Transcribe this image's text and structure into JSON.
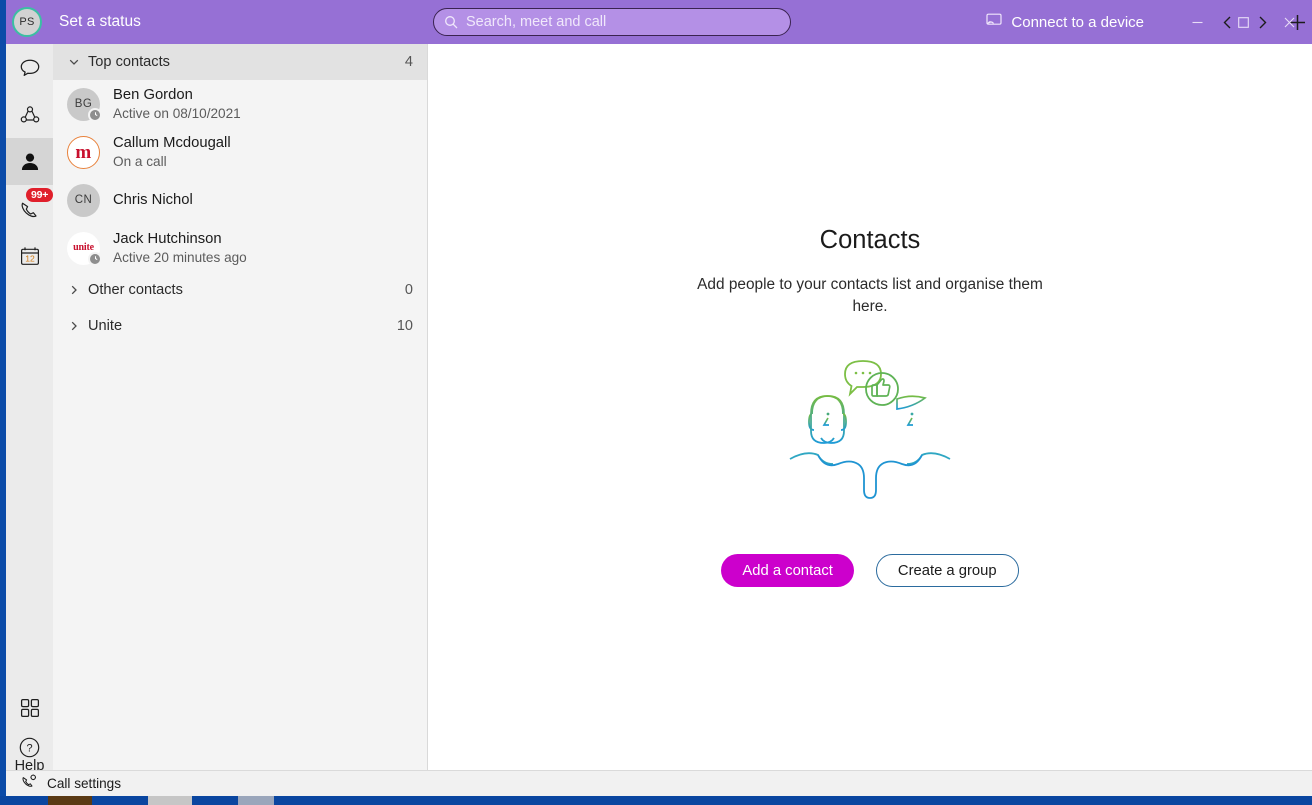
{
  "window": {
    "titlebar": {
      "avatar_initials": "PS",
      "status_label": "Set a status",
      "back_icon": "chevron-left-icon",
      "forward_icon": "chevron-right-icon",
      "new_icon": "plus-icon",
      "connect_label": "Connect to a device",
      "connect_icon": "cast-icon",
      "minimize_icon": "minimize-icon",
      "maximize_icon": "maximize-icon",
      "close_icon": "close-icon"
    },
    "search": {
      "placeholder": "Search, meet and call",
      "value": "",
      "icon": "search-icon"
    }
  },
  "rail": {
    "items": [
      {
        "name": "chat",
        "icon": "chat-bubble-icon",
        "badge": "",
        "active": false
      },
      {
        "name": "meet",
        "icon": "meet-now-icon",
        "badge": "",
        "active": false
      },
      {
        "name": "contacts",
        "icon": "person-icon",
        "badge": "",
        "active": true
      },
      {
        "name": "calls",
        "icon": "phone-icon",
        "badge": "99+",
        "active": false
      },
      {
        "name": "calendar",
        "icon": "calendar-icon",
        "badge": "",
        "active": false,
        "day": "12"
      }
    ],
    "apps_icon": "apps-grid-icon",
    "help_icon": "question-circle-icon",
    "help_label": "Help"
  },
  "contacts_panel": {
    "groups": [
      {
        "title": "Top contacts",
        "count": "4",
        "expanded": true,
        "caret": "chevron-down-icon",
        "contacts": [
          {
            "name": "Ben Gordon",
            "status": "Active on 08/10/2021",
            "avatar_type": "initials",
            "initials": "BG",
            "presence": "clock-icon"
          },
          {
            "name": "Callum Mcdougall",
            "status": "On a call",
            "avatar_type": "logo-m",
            "initials": "",
            "presence": ""
          },
          {
            "name": "Chris Nichol",
            "status": "",
            "avatar_type": "initials",
            "initials": "CN",
            "presence": ""
          },
          {
            "name": "Jack Hutchinson",
            "status": "Active 20 minutes ago",
            "avatar_type": "logo-unite",
            "initials": "",
            "presence": "clock-icon"
          }
        ]
      },
      {
        "title": "Other contacts",
        "count": "0",
        "expanded": false,
        "caret": "chevron-right-icon",
        "contacts": []
      },
      {
        "title": "Unite",
        "count": "10",
        "expanded": false,
        "caret": "chevron-right-icon",
        "contacts": []
      }
    ]
  },
  "main": {
    "title": "Contacts",
    "subtitle": "Add people to your contacts list and organise them here.",
    "illustration": "two-people-chat-illustration",
    "primary_button": "Add a contact",
    "secondary_button": "Create a group"
  },
  "statusbar": {
    "icon": "call-settings-icon",
    "label": "Call settings"
  },
  "colors": {
    "titlebar_purple": "#9670D5",
    "search_field": "#B490E6",
    "accent_magenta": "#CC00CC",
    "badge_red": "#E01F2B",
    "rail_bg": "#EBEBEB",
    "panel_bg": "#F4F4F4",
    "presence_away": "#8E8E8E",
    "avatar_ring_green": "#3BBFA3",
    "taskbar_blue": "#0A46A0"
  }
}
